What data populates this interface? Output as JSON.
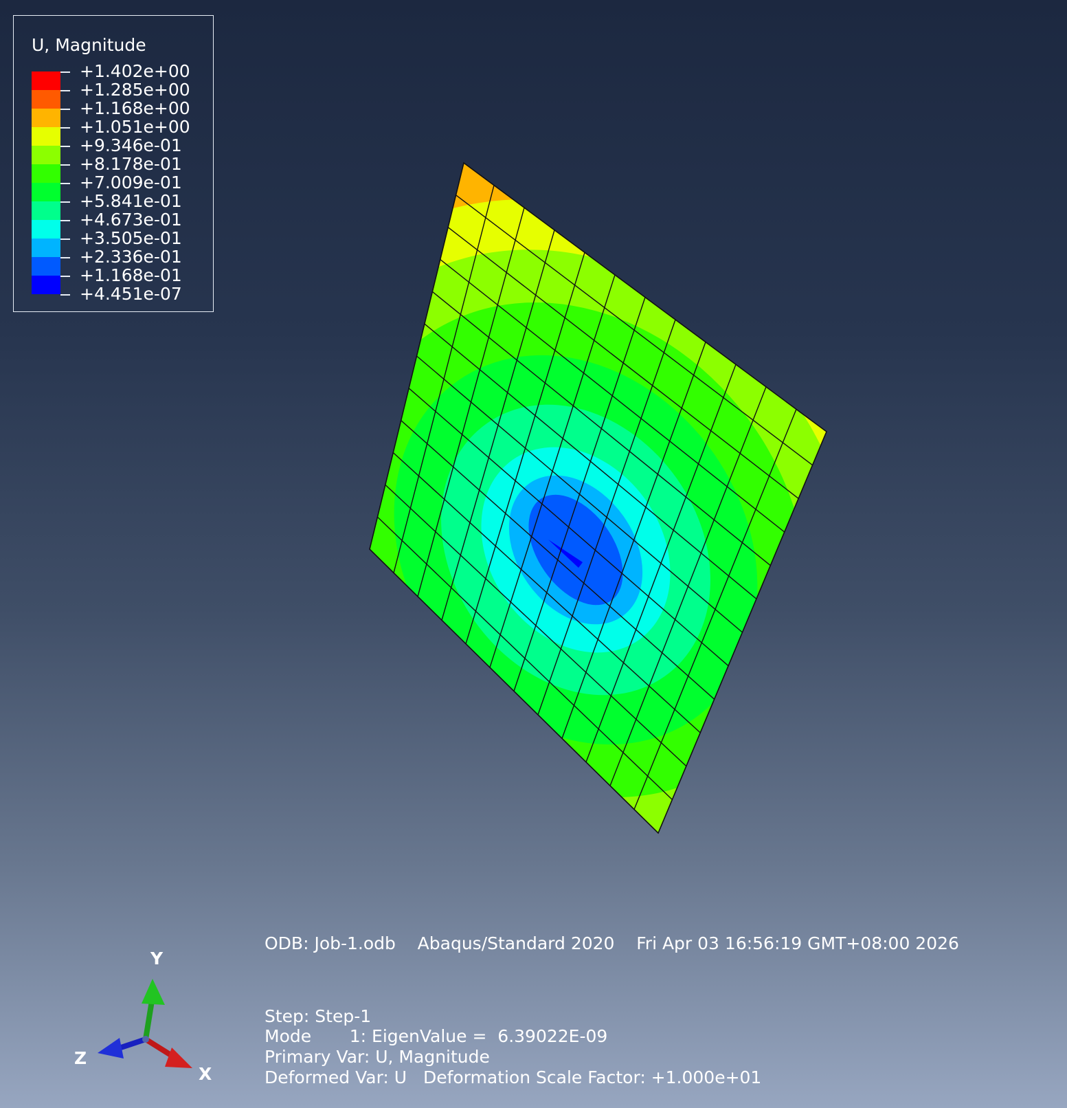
{
  "legend": {
    "title": "U, Magnitude",
    "labels": [
      "+1.402e+00",
      "+1.285e+00",
      "+1.168e+00",
      "+1.051e+00",
      "+9.346e-01",
      "+8.178e-01",
      "+7.009e-01",
      "+5.841e-01",
      "+4.673e-01",
      "+3.505e-01",
      "+2.336e-01",
      "+1.168e-01",
      "+4.451e-07"
    ],
    "colors": [
      "#ff0000",
      "#ff5a00",
      "#ffb400",
      "#e6ff00",
      "#8cff00",
      "#32ff00",
      "#00ff2e",
      "#00ff8c",
      "#00ffea",
      "#00b4ff",
      "#005aff",
      "#0000ff"
    ]
  },
  "info": {
    "header": "ODB: Job-1.odb    Abaqus/Standard 2020    Fri Apr 03 16:56:19 GMT+08:00 2026",
    "step": "Step: Step-1",
    "mode": "Mode       1: EigenValue =  6.39022E-09",
    "primary": "Primary Var: U, Magnitude",
    "deformed": "Deformed Var: U   Deformation Scale Factor: +1.000e+01"
  },
  "triad": {
    "x": "X",
    "y": "Y",
    "z": "Z"
  }
}
